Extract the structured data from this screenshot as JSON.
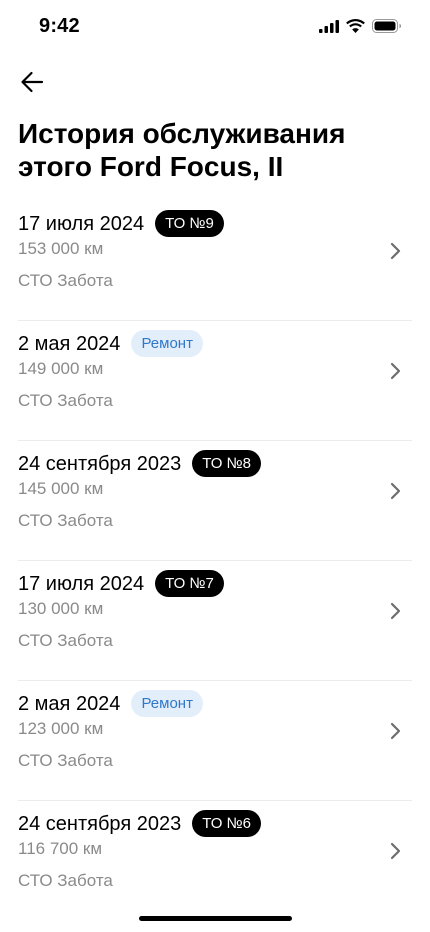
{
  "status_bar": {
    "time": "9:42",
    "icons": [
      "signal-icon",
      "wifi-icon",
      "battery-icon"
    ]
  },
  "header": {
    "back_icon": "arrow-left-icon",
    "title": "История обслуживания этого Ford Focus, II"
  },
  "records": [
    {
      "date": "17 июля 2024",
      "badge": "ТО №9",
      "badge_type": "service",
      "mileage": "153 000 км",
      "shop": "СТО Забота"
    },
    {
      "date": "2 мая 2024",
      "badge": "Ремонт",
      "badge_type": "repair",
      "mileage": "149 000 км",
      "shop": "СТО Забота"
    },
    {
      "date": "24 сентября 2023",
      "badge": "ТО №8",
      "badge_type": "service",
      "mileage": "145 000 км",
      "shop": "СТО Забота"
    },
    {
      "date": "17 июля 2024",
      "badge": "ТО №7",
      "badge_type": "service",
      "mileage": "130 000 км",
      "shop": "СТО Забота"
    },
    {
      "date": "2 мая 2024",
      "badge": "Ремонт",
      "badge_type": "repair",
      "mileage": "123 000 км",
      "shop": "СТО Забота"
    },
    {
      "date": "24 сентября 2023",
      "badge": "ТО №6",
      "badge_type": "service",
      "mileage": "116 700 км",
      "shop": "СТО Забота"
    }
  ],
  "colors": {
    "service_badge_bg": "#000000",
    "repair_badge_bg": "#e3eefb",
    "repair_badge_text": "#2f78c9",
    "secondary_text": "#8a8a8a"
  }
}
